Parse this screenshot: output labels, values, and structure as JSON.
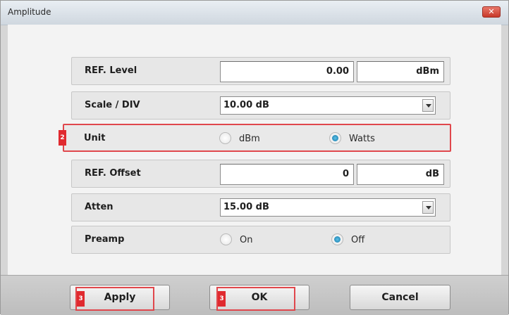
{
  "window": {
    "title": "Amplitude",
    "close_label": "✕"
  },
  "rows": {
    "ref_level": {
      "label": "REF. Level",
      "value": "0.00",
      "unit": "dBm"
    },
    "scale_div": {
      "label": "Scale / DIV",
      "value": "10.00 dB"
    },
    "unit": {
      "label": "Unit",
      "badge": "2",
      "options": [
        "dBm",
        "Watts"
      ],
      "selected": "Watts"
    },
    "ref_offset": {
      "label": "REF. Offset",
      "value": "0",
      "unit": "dB"
    },
    "atten": {
      "label": "Atten",
      "value": "15.00 dB"
    },
    "preamp": {
      "label": "Preamp",
      "options": [
        "On",
        "Off"
      ],
      "selected": "Off"
    }
  },
  "buttons": {
    "apply": {
      "label": "Apply",
      "badge": "3"
    },
    "ok": {
      "label": "OK",
      "badge": "3"
    },
    "cancel": {
      "label": "Cancel"
    }
  },
  "colors": {
    "highlight": "#e0474c",
    "badge": "#e02a2f",
    "radio_selected": "#1177a8"
  }
}
